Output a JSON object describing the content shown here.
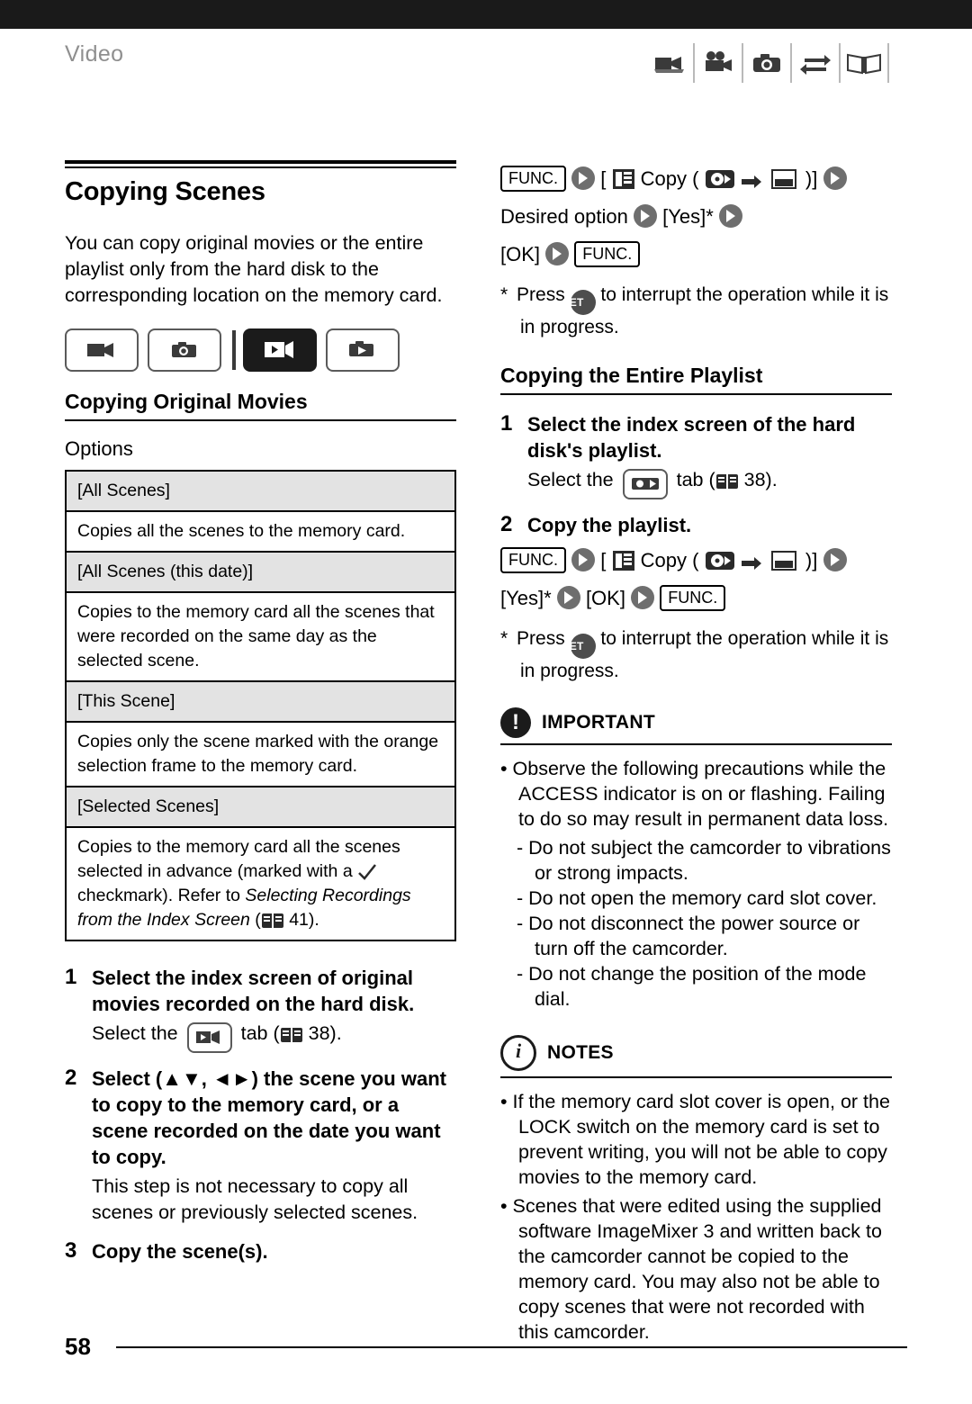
{
  "header": {
    "title": "Video",
    "icons": [
      "video-camera-icon",
      "movie-camera-icon",
      "photo-camera-icon",
      "transfer-icon",
      "book-icon"
    ]
  },
  "left": {
    "chapter_title": "Copying Scenes",
    "intro": "You can copy original movies or the entire playlist only from the hard disk to the corresponding location on the memory card.",
    "mode_tabs": [
      "camera-movie-icon",
      "camera-photo-icon",
      "play-movie-icon",
      "play-photo-icon"
    ],
    "section_title": "Copying Original Movies",
    "options_heading": "Options",
    "options": [
      {
        "name": "[All Scenes]",
        "desc": "Copies all the scenes to the memory card."
      },
      {
        "name": "[All Scenes (this date)]",
        "desc": "Copies to the memory card all the scenes that were recorded on the same day as the selected scene."
      },
      {
        "name": "[This Scene]",
        "desc": "Copies only the scene marked with the orange selection frame to the memory card."
      },
      {
        "name": "[Selected Scenes]",
        "desc_1": "Copies to the memory card all the scenes selected in advance (marked with a ",
        "desc_2": "checkmark). Refer to ",
        "desc_italic": "Selecting Recordings from the Index Screen",
        "desc_3": " (",
        "page_ref": "41",
        "desc_4": ")."
      }
    ],
    "steps": [
      {
        "num": "1",
        "text": "Select the index screen of original movies recorded on the hard disk.",
        "sub_pre": "Select the",
        "sub_post": "tab (",
        "page_ref": "38",
        "sub_end": ")."
      },
      {
        "num": "2",
        "text": "Select (▲▼, ◄►) the scene you want to copy to the memory card, or a scene recorded on the date you want to copy.",
        "note": "This step is not necessary to copy all scenes or previously selected scenes."
      },
      {
        "num": "3",
        "text": "Copy the scene(s)."
      }
    ]
  },
  "right": {
    "seq1": {
      "func": "FUNC.",
      "copy_label": "Copy (",
      "copy_close": ")]",
      "bracket_open": "[",
      "desired_option": "Desired option",
      "yes": "[Yes]*",
      "ok": "[OK]",
      "func2": "FUNC."
    },
    "footnote1_pre": "Press",
    "footnote1_post": "to interrupt the operation while it is in progress.",
    "playlist_title": "Copying the Entire Playlist",
    "playlist_steps": [
      {
        "num": "1",
        "text": "Select the index screen of the hard disk's playlist.",
        "sub_pre": "Select the",
        "sub_post": "tab (",
        "page_ref": "38",
        "sub_end": ")."
      },
      {
        "num": "2",
        "text": "Copy the playlist."
      }
    ],
    "seq2": {
      "func": "FUNC.",
      "copy_label": "Copy (",
      "copy_close": ")]",
      "yes": "[Yes]*",
      "ok": "[OK]",
      "func2": "FUNC."
    },
    "footnote2_pre": "Press",
    "footnote2_post": "to interrupt the operation while it is in progress.",
    "important": {
      "title": "IMPORTANT",
      "bullet": "Observe the following precautions while the ACCESS indicator is on or flashing. Failing to do so may result in permanent data loss.",
      "dashes": [
        "Do not subject the camcorder to vibrations or strong impacts.",
        "Do not open the memory card slot cover.",
        "Do not disconnect the power source or turn off the camcorder.",
        "Do not change the position of the mode dial."
      ]
    },
    "notes": {
      "title": "NOTES",
      "bullets": [
        "If the memory card slot cover is open, or the LOCK switch on the memory card is set to prevent writing, you will not be able to copy movies to the memory card.",
        "Scenes that were edited using the supplied software ImageMixer 3 and written back to the camcorder cannot be copied to the memory card. You may also not be able to copy scenes that were not recorded with this camcorder."
      ]
    }
  },
  "footer": {
    "page_number": "58"
  }
}
